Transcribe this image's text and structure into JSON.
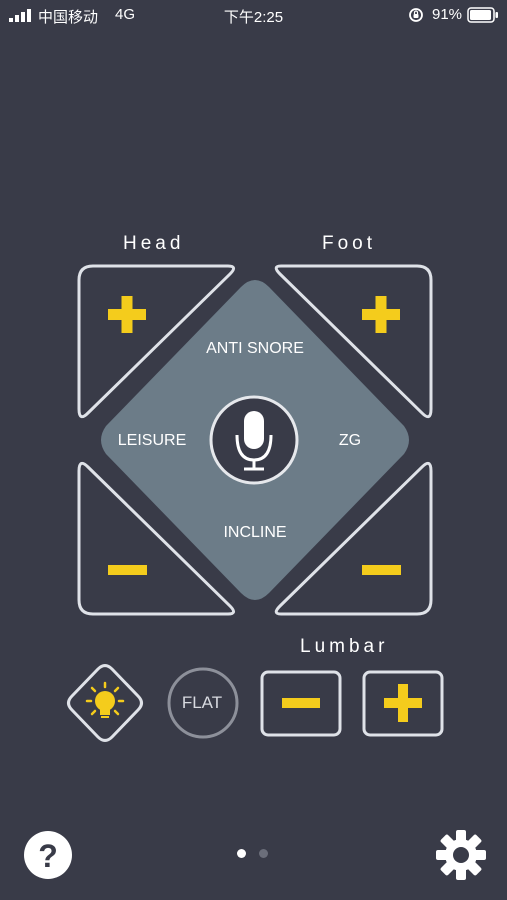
{
  "status_bar": {
    "carrier": "中国移动",
    "network": "4G",
    "time": "下午2:25",
    "battery_percent": "91%"
  },
  "sections": {
    "head": "Head",
    "foot": "Foot",
    "lumbar": "Lumbar"
  },
  "presets": {
    "anti_snore": "ANTI SNORE",
    "leisure": "LEISURE",
    "zg": "ZG",
    "incline": "INCLINE",
    "flat": "FLAT"
  },
  "icons": {
    "head_up": "plus-icon",
    "foot_up": "plus-icon",
    "head_down": "minus-icon",
    "foot_down": "minus-icon",
    "voice": "microphone-icon",
    "light": "light-bulb-icon",
    "lumbar_down": "minus-icon",
    "lumbar_up": "plus-icon",
    "help": "help-icon",
    "settings": "gear-icon"
  },
  "pager": {
    "total": 2,
    "current": 1
  },
  "colors": {
    "background": "#393b48",
    "accent_yellow": "#f4cc1c",
    "panel_outline": "#dfe2e8",
    "center_diamond": "#6c7c88"
  }
}
